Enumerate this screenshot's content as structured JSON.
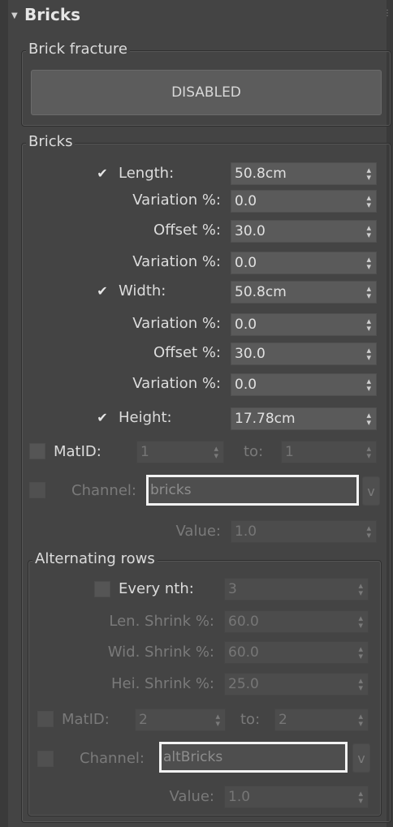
{
  "rollout": {
    "title": "Bricks",
    "arrow_icon": "collapse-triangle-icon"
  },
  "brick_fracture": {
    "group_label": "Brick fracture",
    "button_label": "DISABLED"
  },
  "bricks": {
    "group_label": "Bricks",
    "length_label": "Length:",
    "length_value": "50.8cm",
    "length_var1_label": "Variation %:",
    "length_var1_value": "0.0",
    "length_offset_label": "Offset %:",
    "length_offset_value": "30.0",
    "length_var2_label": "Variation %:",
    "length_var2_value": "0.0",
    "width_label": "Width:",
    "width_value": "50.8cm",
    "width_var1_label": "Variation %:",
    "width_var1_value": "0.0",
    "width_offset_label": "Offset %:",
    "width_offset_value": "30.0",
    "width_var2_label": "Variation %:",
    "width_var2_value": "0.0",
    "height_label": "Height:",
    "height_value": "17.78cm",
    "matid_label": "MatID:",
    "matid_value": "1",
    "to_label": "to:",
    "to_value": "1",
    "channel_label": "Channel:",
    "channel_value": "bricks",
    "v_label": "v",
    "value_label": "Value:",
    "value_value": "1.0"
  },
  "alternating": {
    "group_label": "Alternating rows",
    "every_nth_label": "Every nth:",
    "every_nth_value": "3",
    "len_shrink_label": "Len. Shrink %:",
    "len_shrink_value": "60.0",
    "wid_shrink_label": "Wid. Shrink %:",
    "wid_shrink_value": "60.0",
    "hei_shrink_label": "Hei. Shrink %:",
    "hei_shrink_value": "25.0",
    "matid_label": "MatID:",
    "matid_value": "2",
    "to_label": "to:",
    "to_value": "2",
    "channel_label": "Channel:",
    "channel_value": "altBricks",
    "v_label": "v",
    "value_label": "Value:",
    "value_value": "1.0"
  }
}
